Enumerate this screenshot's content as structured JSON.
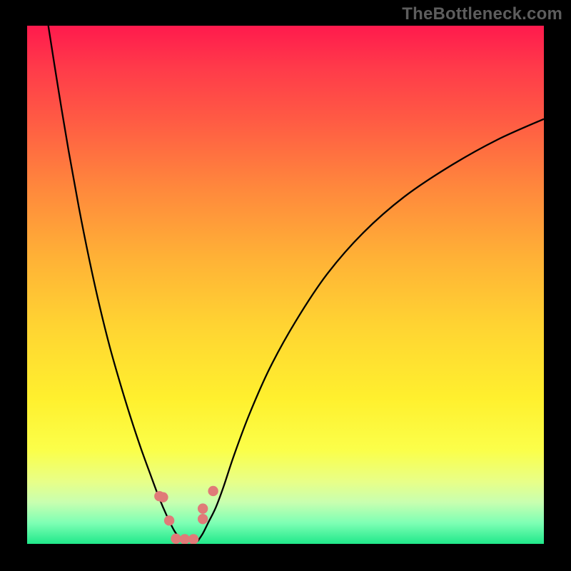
{
  "watermark": {
    "text": "TheBottleneck.com"
  },
  "colors": {
    "frame": "#000000",
    "curve": "#000000",
    "marker": "#e07a78",
    "watermark": "#5d5d5d"
  },
  "chart_data": {
    "type": "line",
    "title": "",
    "xlabel": "",
    "ylabel": "",
    "xlim": [
      0,
      100
    ],
    "ylim": [
      0,
      100
    ],
    "series": [
      {
        "name": "left-curve",
        "x": [
          4.1,
          6,
          8,
          10,
          12,
          14,
          16,
          18,
          20,
          22,
          24,
          25.5,
          27,
          28.5,
          30
        ],
        "y": [
          100,
          88,
          76,
          65,
          55,
          46,
          38,
          31,
          24.5,
          18.5,
          13,
          9,
          5.5,
          2.5,
          0.5
        ]
      },
      {
        "name": "right-curve",
        "x": [
          33,
          34,
          35,
          36.5,
          38,
          40,
          43,
          47,
          52,
          58,
          65,
          73,
          82,
          91,
          100
        ],
        "y": [
          0.5,
          2,
          4,
          7,
          11,
          17,
          25,
          34,
          43,
          52,
          60,
          67,
          73,
          78,
          82
        ]
      }
    ],
    "markers": [
      {
        "x": 25.6,
        "y": 9.2
      },
      {
        "x": 26.3,
        "y": 9.0
      },
      {
        "x": 27.5,
        "y": 4.5
      },
      {
        "x": 28.8,
        "y": 1.0
      },
      {
        "x": 30.5,
        "y": 0.9
      },
      {
        "x": 32.2,
        "y": 0.9
      },
      {
        "x": 34.0,
        "y": 4.8
      },
      {
        "x": 34.0,
        "y": 6.8
      },
      {
        "x": 36.0,
        "y": 10.2
      }
    ]
  }
}
